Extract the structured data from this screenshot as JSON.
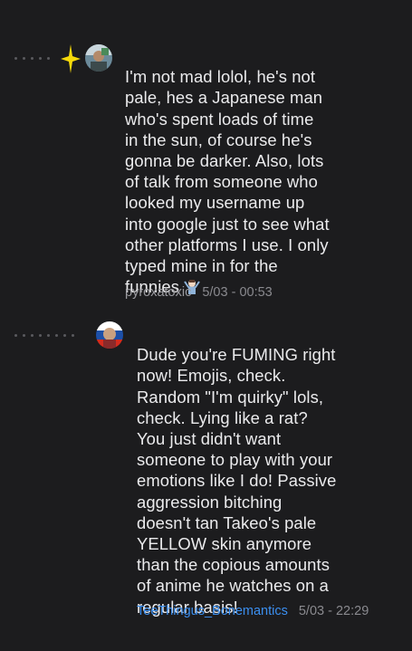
{
  "comments": [
    {
      "text": "I'm not mad lolol, he's not\npale, hes a Japanese man\nwho's spent loads of time\nin the sun, of course he's\ngonna be darker. Also, lots\nof talk from someone who\nlooked my username up\ninto google just to see what\nother platforms I use. I only\ntyped mine in for the\nfunnies",
      "emoji": "person-shrugging-emoji",
      "author": "pyroxatoxic",
      "timestamp": "5/03 - 00:53",
      "icons": [
        "thread-dots-icon",
        "sparkle-icon",
        "avatar-icon"
      ],
      "colors": {
        "author": "#9b9ba0",
        "sparkle": "#f5d90a"
      }
    },
    {
      "text": "Dude you're FUMING right\nnow! Emojis, check.\nRandom \"I'm quirky\" lols,\ncheck. Lying like a rat?\nYou just didn't want\nsomeone to play with your\nemotions like I do! Passive\naggression bitching\ndoesn't tan Takeo's pale\nYELLOW skin anymore\nthan the copious amounts\nof anime he watches on a\nregular basis!",
      "author": "TeeThingus_Bonemantics",
      "timestamp": "5/03 - 22:29",
      "icons": [
        "thread-dots-icon",
        "avatar-icon"
      ],
      "colors": {
        "author": "#3b8ff0"
      }
    }
  ],
  "colors": {
    "background": "#1c1c1e",
    "text": "#ebebed"
  }
}
